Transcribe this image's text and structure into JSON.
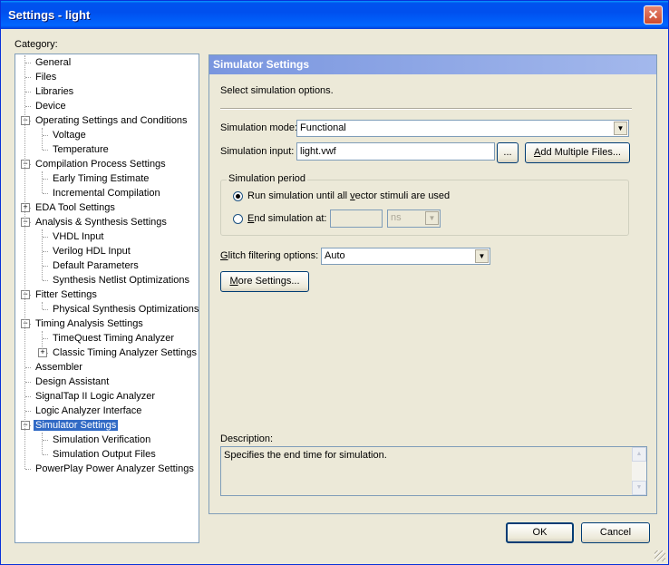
{
  "window": {
    "title": "Settings - light",
    "close_glyph": "✕",
    "accent": "#0053ee"
  },
  "category_label": "Category:",
  "tree": {
    "items": [
      {
        "label": "General",
        "level": 0,
        "expander": ""
      },
      {
        "label": "Files",
        "level": 0,
        "expander": ""
      },
      {
        "label": "Libraries",
        "level": 0,
        "expander": ""
      },
      {
        "label": "Device",
        "level": 0,
        "expander": ""
      },
      {
        "label": "Operating Settings and Conditions",
        "level": 0,
        "expander": "−"
      },
      {
        "label": "Voltage",
        "level": 1,
        "expander": ""
      },
      {
        "label": "Temperature",
        "level": 1,
        "expander": ""
      },
      {
        "label": "Compilation Process Settings",
        "level": 0,
        "expander": "−"
      },
      {
        "label": "Early Timing Estimate",
        "level": 1,
        "expander": ""
      },
      {
        "label": "Incremental Compilation",
        "level": 1,
        "expander": ""
      },
      {
        "label": "EDA Tool Settings",
        "level": 0,
        "expander": "+"
      },
      {
        "label": "Analysis & Synthesis Settings",
        "level": 0,
        "expander": "−"
      },
      {
        "label": "VHDL Input",
        "level": 1,
        "expander": ""
      },
      {
        "label": "Verilog HDL Input",
        "level": 1,
        "expander": ""
      },
      {
        "label": "Default Parameters",
        "level": 1,
        "expander": ""
      },
      {
        "label": "Synthesis Netlist Optimizations",
        "level": 1,
        "expander": ""
      },
      {
        "label": "Fitter Settings",
        "level": 0,
        "expander": "−"
      },
      {
        "label": "Physical Synthesis Optimizations",
        "level": 1,
        "expander": ""
      },
      {
        "label": "Timing Analysis Settings",
        "level": 0,
        "expander": "−"
      },
      {
        "label": "TimeQuest Timing Analyzer",
        "level": 1,
        "expander": ""
      },
      {
        "label": "Classic Timing Analyzer Settings",
        "level": 1,
        "expander": "+"
      },
      {
        "label": "Assembler",
        "level": 0,
        "expander": ""
      },
      {
        "label": "Design Assistant",
        "level": 0,
        "expander": ""
      },
      {
        "label": "SignalTap II Logic Analyzer",
        "level": 0,
        "expander": ""
      },
      {
        "label": "Logic Analyzer Interface",
        "level": 0,
        "expander": ""
      },
      {
        "label": "Simulator Settings",
        "level": 0,
        "expander": "−",
        "selected": true
      },
      {
        "label": "Simulation Verification",
        "level": 1,
        "expander": ""
      },
      {
        "label": "Simulation Output Files",
        "level": 1,
        "expander": ""
      },
      {
        "label": "PowerPlay Power Analyzer Settings",
        "level": 0,
        "expander": ""
      }
    ]
  },
  "panel": {
    "header": "Simulator Settings",
    "intro": "Select simulation options.",
    "sim_mode_label": "Simulation mode:",
    "sim_mode_value": "Functional",
    "sim_input_label": "Simulation input:",
    "sim_input_value": "light.vwf",
    "browse_label": "...",
    "add_files_label_a": "A",
    "add_files_label_b": "dd Multiple Files...",
    "period_title": "Simulation period",
    "radio_run_a": "Run simulation until all ",
    "radio_run_u": "v",
    "radio_run_b": "ector stimuli are used",
    "radio_end_u": "E",
    "radio_end_b": "nd simulation at:",
    "end_value": "",
    "end_unit": "ns",
    "glitch_label_u": "G",
    "glitch_label_b": "litch filtering options:",
    "glitch_value": "Auto",
    "more_settings_u": "M",
    "more_settings_b": "ore Settings...",
    "description_label": "Description:",
    "description_text": "Specifies the end time for simulation."
  },
  "footer": {
    "ok_label": "OK",
    "cancel_label": "Cancel"
  }
}
